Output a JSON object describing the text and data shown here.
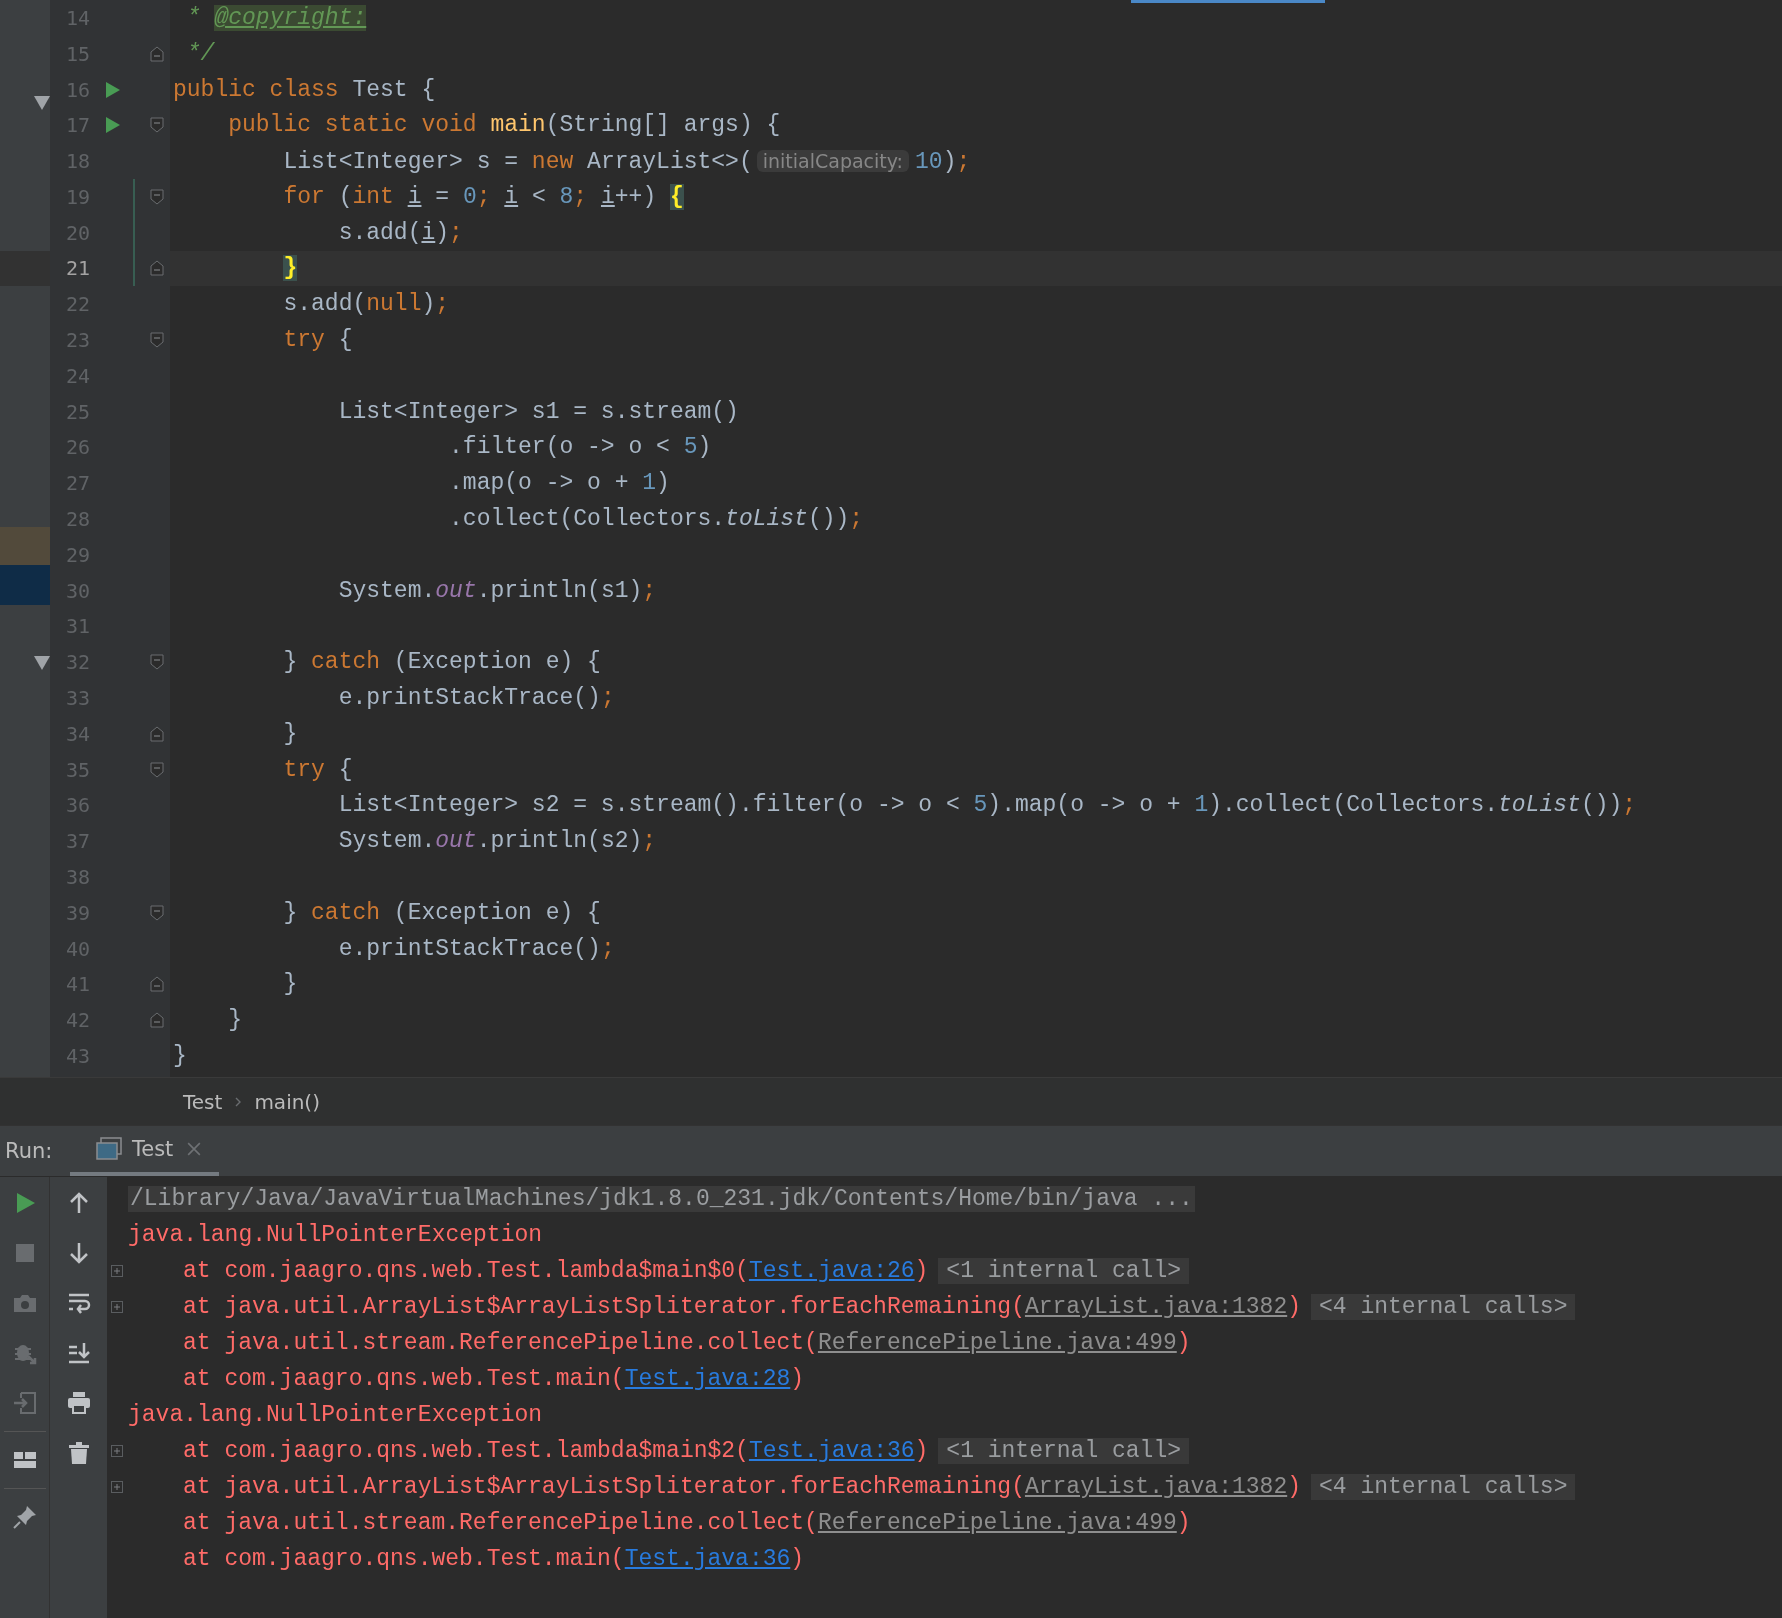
{
  "editor": {
    "lines": [
      {
        "number": "14",
        "tokens": [
          {
            "text": " * ",
            "kind": "comment"
          },
          {
            "text": "@copyright:",
            "kind": "doctag"
          }
        ]
      },
      {
        "number": "15",
        "fold_end": true,
        "tokens": [
          {
            "text": " */",
            "kind": "comment"
          }
        ]
      },
      {
        "number": "16",
        "run": true,
        "tokens": [
          {
            "text": "public class",
            "kind": "kw"
          },
          {
            "text": " Test {",
            "kind": "id"
          }
        ]
      },
      {
        "number": "17",
        "run": true,
        "fold_start": true,
        "tokens": [
          {
            "text": "    public static void ",
            "kind": "kw"
          },
          {
            "text": "main",
            "kind": "fn"
          },
          {
            "text": "(String[] args) {",
            "kind": "id"
          }
        ]
      },
      {
        "number": "18",
        "tokens": [
          {
            "text": "        List<Integer> s = ",
            "kind": "id"
          },
          {
            "text": "new",
            "kind": "kw"
          },
          {
            "text": " ArrayList<>(",
            "kind": "id"
          },
          {
            "text": "initialCapacity:",
            "kind": "hint"
          },
          {
            "text": "10",
            "kind": "num"
          },
          {
            "text": ")",
            "kind": "id"
          },
          {
            "text": ";",
            "kind": "kw"
          }
        ]
      },
      {
        "number": "19",
        "fold_start": true,
        "changed": true,
        "tokens": [
          {
            "text": "        for",
            "kind": "kw"
          },
          {
            "text": " (",
            "kind": "id"
          },
          {
            "text": "int ",
            "kind": "kw"
          },
          {
            "text": "i",
            "kind": "var"
          },
          {
            "text": " = ",
            "kind": "id"
          },
          {
            "text": "0",
            "kind": "num"
          },
          {
            "text": "; ",
            "kind": "kw"
          },
          {
            "text": "i",
            "kind": "var"
          },
          {
            "text": " < ",
            "kind": "id"
          },
          {
            "text": "8",
            "kind": "num"
          },
          {
            "text": "; ",
            "kind": "kw"
          },
          {
            "text": "i",
            "kind": "var"
          },
          {
            "text": "++) ",
            "kind": "id"
          },
          {
            "text": "{",
            "kind": "match"
          }
        ]
      },
      {
        "number": "20",
        "changed": true,
        "tokens": [
          {
            "text": "            s.add(",
            "kind": "id"
          },
          {
            "text": "i",
            "kind": "var"
          },
          {
            "text": ")",
            "kind": "id"
          },
          {
            "text": ";",
            "kind": "kw"
          }
        ]
      },
      {
        "number": "21",
        "fold_end": true,
        "changed": true,
        "current": true,
        "tokens": [
          {
            "text": "        }",
            "kind": "match"
          }
        ]
      },
      {
        "number": "22",
        "tokens": [
          {
            "text": "        s.add(",
            "kind": "id"
          },
          {
            "text": "null",
            "kind": "kw"
          },
          {
            "text": ")",
            "kind": "id"
          },
          {
            "text": ";",
            "kind": "kw"
          }
        ]
      },
      {
        "number": "23",
        "fold_start": true,
        "tokens": [
          {
            "text": "        try",
            "kind": "kw"
          },
          {
            "text": " {",
            "kind": "id"
          }
        ]
      },
      {
        "number": "24"
      },
      {
        "number": "25",
        "tokens": [
          {
            "text": "            List<Integer> s1 = s.stream()",
            "kind": "id"
          }
        ]
      },
      {
        "number": "26",
        "tokens": [
          {
            "text": "                    .filter(o -> o < ",
            "kind": "id"
          },
          {
            "text": "5",
            "kind": "num"
          },
          {
            "text": ")",
            "kind": "id"
          }
        ]
      },
      {
        "number": "27",
        "tokens": [
          {
            "text": "                    .map(o -> o + ",
            "kind": "id"
          },
          {
            "text": "1",
            "kind": "num"
          },
          {
            "text": ")",
            "kind": "id"
          }
        ]
      },
      {
        "number": "28",
        "tokens": [
          {
            "text": "                    .collect(Collectors.",
            "kind": "id"
          },
          {
            "text": "toList",
            "kind": "italic"
          },
          {
            "text": "())",
            "kind": "id"
          },
          {
            "text": ";",
            "kind": "kw"
          }
        ]
      },
      {
        "number": "29"
      },
      {
        "number": "30",
        "tokens": [
          {
            "text": "            System.",
            "kind": "id"
          },
          {
            "text": "out",
            "kind": "static"
          },
          {
            "text": ".println(s1)",
            "kind": "id"
          },
          {
            "text": ";",
            "kind": "kw"
          }
        ]
      },
      {
        "number": "31"
      },
      {
        "number": "32",
        "fold_start": true,
        "tokens": [
          {
            "text": "        } ",
            "kind": "id"
          },
          {
            "text": "catch",
            "kind": "kw"
          },
          {
            "text": " (Exception e) {",
            "kind": "id"
          }
        ]
      },
      {
        "number": "33",
        "tokens": [
          {
            "text": "            e.printStackTrace()",
            "kind": "id"
          },
          {
            "text": ";",
            "kind": "kw"
          }
        ]
      },
      {
        "number": "34",
        "fold_end": true,
        "tokens": [
          {
            "text": "        }",
            "kind": "id"
          }
        ]
      },
      {
        "number": "35",
        "fold_start": true,
        "tokens": [
          {
            "text": "        try",
            "kind": "kw"
          },
          {
            "text": " {",
            "kind": "id"
          }
        ]
      },
      {
        "number": "36",
        "tokens": [
          {
            "text": "            List<Integer> s2 = s.stream().filter(o -> o < ",
            "kind": "id"
          },
          {
            "text": "5",
            "kind": "num"
          },
          {
            "text": ").map(o -> o + ",
            "kind": "id"
          },
          {
            "text": "1",
            "kind": "num"
          },
          {
            "text": ").collect(Collectors.",
            "kind": "id"
          },
          {
            "text": "toList",
            "kind": "italic"
          },
          {
            "text": "())",
            "kind": "id"
          },
          {
            "text": ";",
            "kind": "kw"
          }
        ]
      },
      {
        "number": "37",
        "tokens": [
          {
            "text": "            System.",
            "kind": "id"
          },
          {
            "text": "out",
            "kind": "static"
          },
          {
            "text": ".println(s2)",
            "kind": "id"
          },
          {
            "text": ";",
            "kind": "kw"
          }
        ]
      },
      {
        "number": "38"
      },
      {
        "number": "39",
        "fold_start": true,
        "tokens": [
          {
            "text": "        } ",
            "kind": "id"
          },
          {
            "text": "catch",
            "kind": "kw"
          },
          {
            "text": " (Exception e) {",
            "kind": "id"
          }
        ]
      },
      {
        "number": "40",
        "tokens": [
          {
            "text": "            e.printStackTrace()",
            "kind": "id"
          },
          {
            "text": ";",
            "kind": "kw"
          }
        ]
      },
      {
        "number": "41",
        "fold_end": true,
        "tokens": [
          {
            "text": "        }",
            "kind": "id"
          }
        ]
      },
      {
        "number": "42",
        "fold_end": true,
        "tokens": [
          {
            "text": "    }",
            "kind": "id"
          }
        ]
      },
      {
        "number": "43",
        "tokens": [
          {
            "text": "}",
            "kind": "id"
          }
        ]
      }
    ]
  },
  "breadcrumb": [
    "Test",
    "main()"
  ],
  "run_panel": {
    "label": "Run:",
    "tabs": [
      {
        "label": "Test",
        "selected": true
      }
    ],
    "tools_left": [
      {
        "kind": "run",
        "disabled": false
      },
      {
        "kind": "stop",
        "disabled": true
      },
      {
        "kind": "camera",
        "disabled": true
      },
      {
        "kind": "bug",
        "disabled": true
      },
      {
        "kind": "exit",
        "disabled": true
      },
      {
        "kind": "separator"
      },
      {
        "kind": "layout",
        "disabled": false
      },
      {
        "kind": "separator"
      },
      {
        "kind": "pin",
        "disabled": false
      }
    ],
    "tools_right": [
      {
        "kind": "up"
      },
      {
        "kind": "down"
      },
      {
        "kind": "wrap"
      },
      {
        "kind": "scroll-end"
      },
      {
        "kind": "print"
      },
      {
        "kind": "trash"
      }
    ],
    "console": [
      {
        "kind": "command",
        "text": "/Library/Java/JavaVirtualMachines/jdk1.8.0_231.jdk/Contents/Home/bin/java ..."
      },
      {
        "kind": "error",
        "text": "java.lang.NullPointerException"
      },
      {
        "kind": "frame",
        "expandable": true,
        "text": "at com.jaagro.qns.web.Test.lambda$main$0(",
        "link": "Test.java:26",
        "project_file": true,
        "suffix": ")",
        "note": "<1 internal call>"
      },
      {
        "kind": "frame",
        "expandable": true,
        "text": "at java.util.ArrayList$ArrayListSpliterator.forEachRemaining(",
        "link": "ArrayList.java:1382",
        "project_file": false,
        "suffix": ")",
        "note": "<4 internal calls>"
      },
      {
        "kind": "frame",
        "expandable": false,
        "text": "at java.util.stream.ReferencePipeline.collect(",
        "link": "ReferencePipeline.java:499",
        "project_file": false,
        "suffix": ")"
      },
      {
        "kind": "frame",
        "expandable": false,
        "text": "at com.jaagro.qns.web.Test.main(",
        "link": "Test.java:28",
        "project_file": true,
        "suffix": ")"
      },
      {
        "kind": "error",
        "text": "java.lang.NullPointerException"
      },
      {
        "kind": "frame",
        "expandable": true,
        "text": "at com.jaagro.qns.web.Test.lambda$main$2(",
        "link": "Test.java:36",
        "project_file": true,
        "suffix": ")",
        "note": "<1 internal call>"
      },
      {
        "kind": "frame",
        "expandable": true,
        "text": "at java.util.ArrayList$ArrayListSpliterator.forEachRemaining(",
        "link": "ArrayList.java:1382",
        "project_file": false,
        "suffix": ")",
        "note": "<4 internal calls>"
      },
      {
        "kind": "frame",
        "expandable": false,
        "text": "at java.util.stream.ReferencePipeline.collect(",
        "link": "ReferencePipeline.java:499",
        "project_file": false,
        "suffix": ")"
      },
      {
        "kind": "frame",
        "expandable": false,
        "text": "at com.jaagro.qns.web.Test.main(",
        "link": "Test.java:36",
        "project_file": true,
        "suffix": ")"
      }
    ]
  }
}
